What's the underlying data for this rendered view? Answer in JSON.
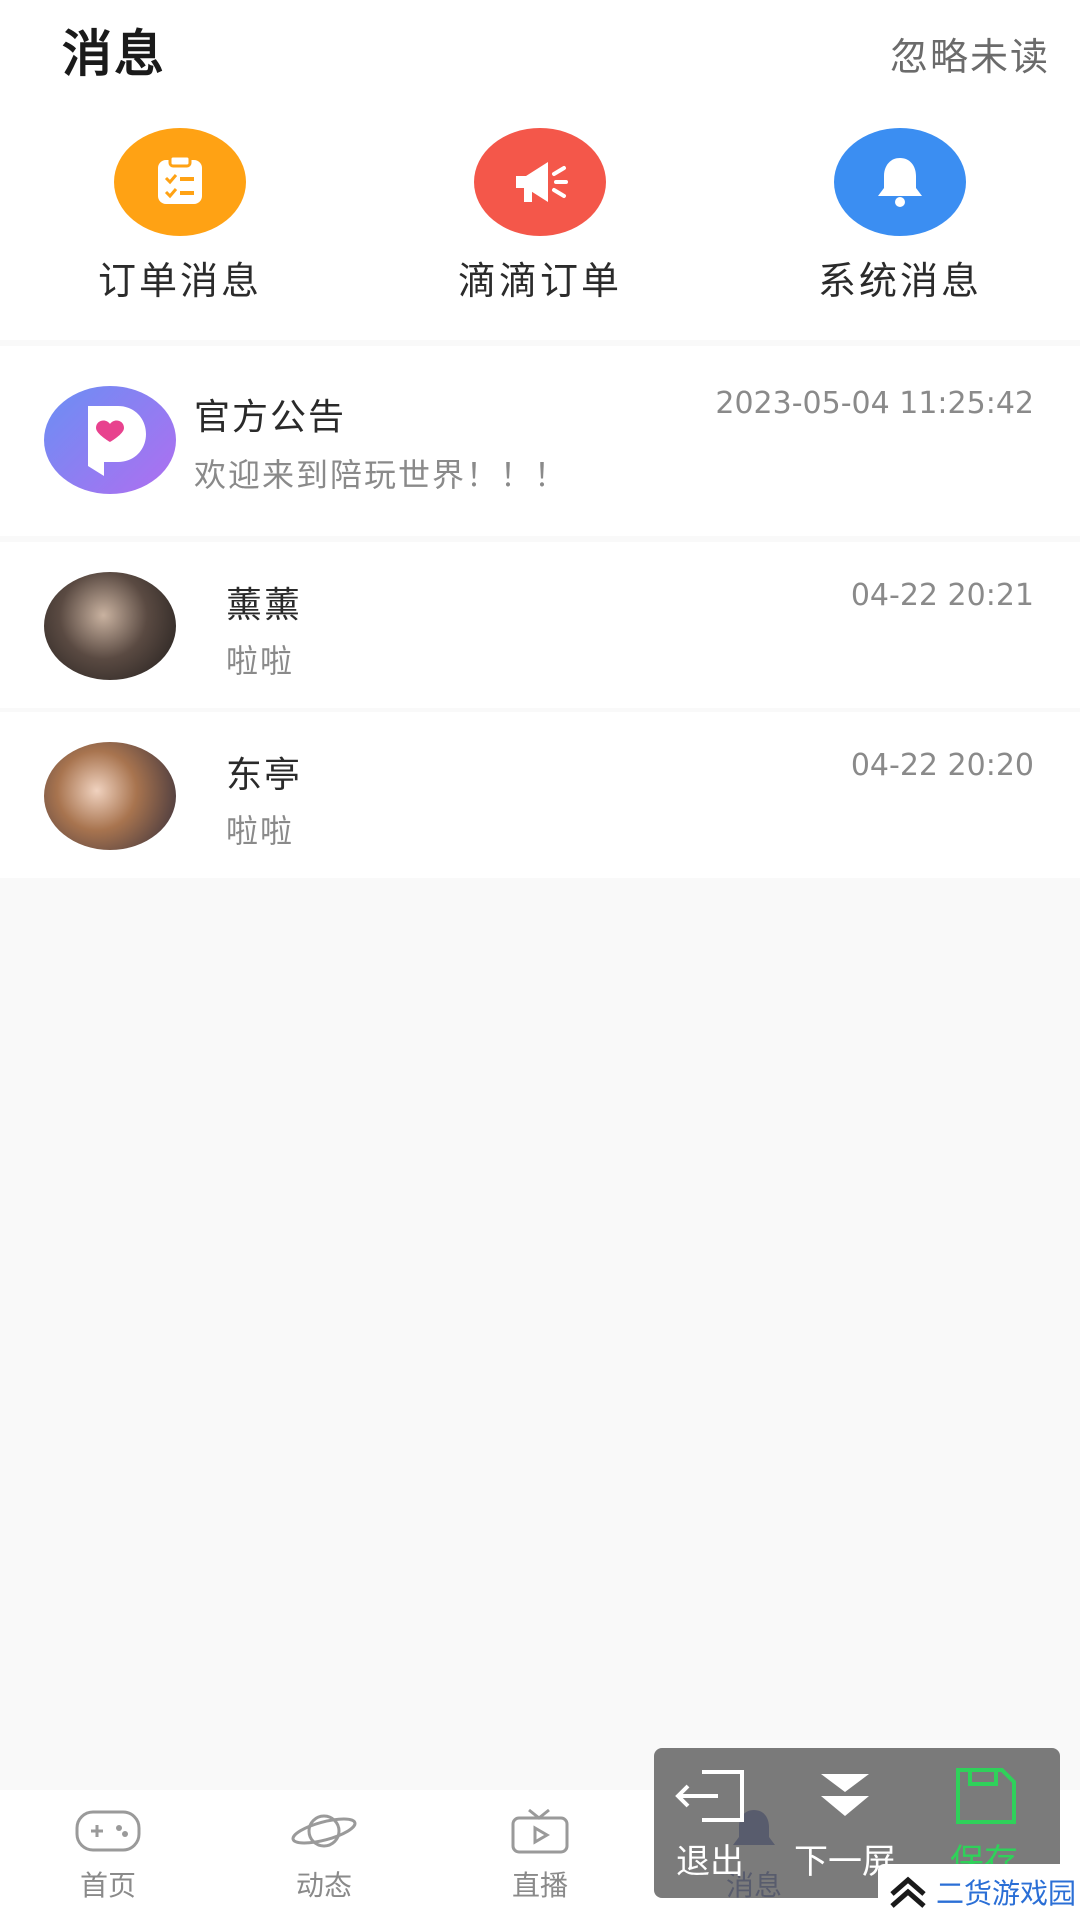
{
  "header": {
    "title": "消息",
    "ignore_unread": "忽略未读"
  },
  "shortcuts": [
    {
      "label": "订单消息",
      "icon": "clipboard-icon",
      "color": "#ff9f14"
    },
    {
      "label": "滴滴订单",
      "icon": "megaphone-icon",
      "color": "#f4594a"
    },
    {
      "label": "系统消息",
      "icon": "bell-icon",
      "color": "#3a8ef0"
    }
  ],
  "conversations": [
    {
      "name": "官方公告",
      "time": "2023-05-04 11:25:42",
      "preview": "欢迎来到陪玩世界！！！",
      "avatar": "app-logo"
    },
    {
      "name": "薰薰",
      "time": "04-22 20:21",
      "preview": "啦啦",
      "avatar": "user-photo"
    },
    {
      "name": "东亭",
      "time": "04-22 20:20",
      "preview": "啦啦",
      "avatar": "user-photo"
    }
  ],
  "tabs": [
    {
      "label": "首页",
      "icon": "gamepad-icon"
    },
    {
      "label": "动态",
      "icon": "planet-icon"
    },
    {
      "label": "直播",
      "icon": "tv-icon"
    },
    {
      "label": "消息",
      "icon": "bell-icon",
      "active": true
    }
  ],
  "overlay": {
    "exit": "退出",
    "next": "下一屏",
    "save": "保存"
  },
  "watermark": "二货游戏园",
  "colors": {
    "active_tab": "#1a2ea0",
    "save_green": "#2fd15a"
  }
}
